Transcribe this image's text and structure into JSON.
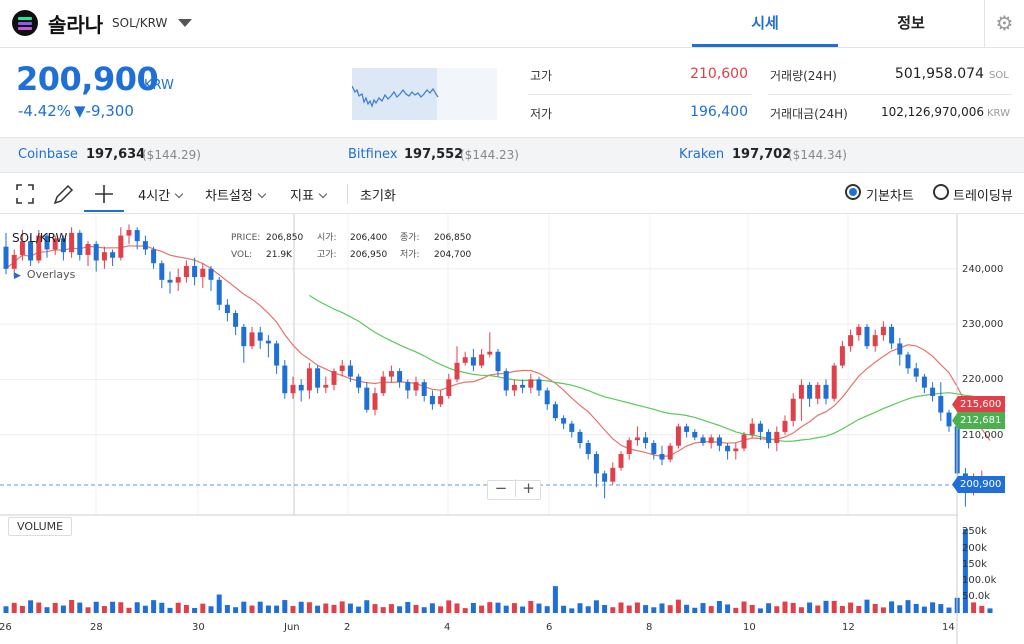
{
  "header": {
    "coin_name": "솔라나",
    "pair": "SOL/KRW",
    "tabs": [
      {
        "label": "시세",
        "active": true
      },
      {
        "label": "정보",
        "active": false
      }
    ],
    "settings_icon": "gear-icon"
  },
  "summary": {
    "price": "200,900",
    "price_unit": "KRW",
    "change_rate": "-4.42%",
    "change_amount": "▼-9,300",
    "high_label": "고가",
    "high_value": "210,600",
    "low_label": "저가",
    "low_value": "196,400",
    "volume_label": "거래량(24H)",
    "volume_value": "501,958.074",
    "volume_unit": "SOL",
    "amount_label": "거래대금(24H)",
    "amount_value": "102,126,970,006",
    "amount_unit": "KRW"
  },
  "exchanges": [
    {
      "name": "Coinbase",
      "price": "197,634",
      "usd": "($144.29)"
    },
    {
      "name": "Bitfinex",
      "price": "197,552",
      "usd": "($144.23)"
    },
    {
      "name": "Kraken",
      "price": "197,702",
      "usd": "($144.34)"
    }
  ],
  "toolbar": {
    "interval": "4시간",
    "chart_settings": "차트설정",
    "indicators": "지표",
    "reset": "초기화",
    "view_basic": "기본차트",
    "view_tradingview": "트레이딩뷰"
  },
  "chart": {
    "symbol": "SOL/KRW",
    "overlays_label": "Overlays",
    "info": {
      "price_label": "PRICE:",
      "price": "206,850",
      "open_label": "시가:",
      "open": "206,400",
      "close_label": "종가:",
      "close": "206,850",
      "vol_label": "VOL:",
      "vol": "21.9K",
      "high_label": "고가:",
      "high": "206,950",
      "low_label": "저가:",
      "low": "204,700"
    },
    "price_axis": [
      "240,000",
      "230,000",
      "220,000",
      "210,000"
    ],
    "volume_axis": [
      "250k",
      "200k",
      "150k",
      "100.0k",
      "50.0k"
    ],
    "time_axis": [
      "26",
      "28",
      "30",
      "Jun",
      "2",
      "4",
      "6",
      "8",
      "10",
      "12",
      "14"
    ],
    "volume_label": "VOLUME",
    "tags": {
      "ma_long": "215,600",
      "ma_short": "212,681",
      "last": "200,900"
    },
    "colors": {
      "up": "#e0404a",
      "down": "#1f6fd6",
      "ma_long": "#e8736b",
      "ma_short": "#5cc85c",
      "accent": "#1f6fd6"
    }
  },
  "chart_data": {
    "type": "candlestick",
    "ylim": [
      195000,
      245000
    ],
    "candles": [
      [
        244000,
        240000,
        246500,
        239000
      ],
      [
        240000,
        242500,
        243500,
        238500
      ],
      [
        242500,
        245000,
        247000,
        241500
      ],
      [
        245000,
        241500,
        246000,
        240500
      ],
      [
        241500,
        246000,
        247000,
        241000
      ],
      [
        246000,
        243500,
        246500,
        242000
      ],
      [
        243500,
        245500,
        246000,
        242500
      ],
      [
        245500,
        243000,
        246000,
        241500
      ],
      [
        243000,
        246500,
        247500,
        242000
      ],
      [
        246500,
        242500,
        247000,
        241500
      ],
      [
        242500,
        244500,
        245000,
        240500
      ],
      [
        244500,
        241500,
        245000,
        239500
      ],
      [
        241500,
        243000,
        244000,
        240000
      ],
      [
        243000,
        242000,
        243500,
        240500
      ],
      [
        242000,
        246000,
        247500,
        241500
      ],
      [
        246000,
        247000,
        248000,
        244500
      ],
      [
        247000,
        245000,
        247500,
        243500
      ],
      [
        245000,
        243500,
        246000,
        242500
      ],
      [
        243500,
        241000,
        244000,
        240000
      ],
      [
        241000,
        238000,
        241500,
        236500
      ],
      [
        238000,
        237500,
        239500,
        235500
      ],
      [
        237500,
        238500,
        240000,
        236000
      ],
      [
        238500,
        240500,
        241500,
        237500
      ],
      [
        240500,
        238500,
        242000,
        237000
      ],
      [
        238500,
        240000,
        241000,
        236500
      ],
      [
        240000,
        238000,
        240500,
        236000
      ],
      [
        238000,
        233500,
        238500,
        232500
      ],
      [
        233500,
        232000,
        234500,
        230500
      ],
      [
        232000,
        229500,
        232500,
        228000
      ],
      [
        229500,
        226000,
        230000,
        223000
      ],
      [
        226000,
        228500,
        229500,
        225500
      ],
      [
        228500,
        227000,
        229500,
        225500
      ],
      [
        227000,
        226500,
        228000,
        224000
      ],
      [
        226500,
        222500,
        227000,
        221000
      ],
      [
        222500,
        217500,
        223500,
        216500
      ],
      [
        217500,
        219000,
        220500,
        216500
      ],
      [
        219000,
        218000,
        220000,
        216000
      ],
      [
        218000,
        222000,
        223000,
        216500
      ],
      [
        222000,
        218500,
        222500,
        217500
      ],
      [
        218500,
        219000,
        220500,
        217500
      ],
      [
        219000,
        221500,
        222000,
        218000
      ],
      [
        221500,
        222500,
        223500,
        220500
      ],
      [
        222500,
        220500,
        223500,
        219500
      ],
      [
        220500,
        218500,
        221000,
        217500
      ],
      [
        218500,
        214500,
        219500,
        214000
      ],
      [
        214500,
        217500,
        218500,
        213500
      ],
      [
        217500,
        220500,
        221500,
        217000
      ],
      [
        220500,
        221500,
        222500,
        219500
      ],
      [
        221500,
        219500,
        222000,
        218500
      ],
      [
        219500,
        218000,
        220000,
        216500
      ],
      [
        218000,
        219500,
        220500,
        217000
      ],
      [
        219500,
        217000,
        220000,
        216000
      ],
      [
        217000,
        215500,
        218000,
        214500
      ],
      [
        215500,
        217000,
        218000,
        215000
      ],
      [
        217000,
        220000,
        221000,
        216500
      ],
      [
        220000,
        223000,
        226000,
        219500
      ],
      [
        223000,
        224000,
        225000,
        222500
      ],
      [
        224000,
        222500,
        225500,
        221500
      ],
      [
        222500,
        224500,
        225500,
        222000
      ],
      [
        224500,
        225000,
        228500,
        224000
      ],
      [
        225000,
        221500,
        225500,
        220500
      ],
      [
        221500,
        218000,
        222000,
        217000
      ],
      [
        218000,
        219000,
        220000,
        217000
      ],
      [
        219000,
        218500,
        220000,
        217500
      ],
      [
        218500,
        220000,
        221000,
        217500
      ],
      [
        220000,
        218000,
        220500,
        217000
      ],
      [
        218000,
        215500,
        218500,
        214500
      ],
      [
        215500,
        213000,
        216000,
        212500
      ],
      [
        213000,
        212000,
        213500,
        211000
      ],
      [
        212000,
        210500,
        212500,
        209500
      ],
      [
        210500,
        208500,
        211000,
        207500
      ],
      [
        208500,
        206500,
        209000,
        205500
      ],
      [
        206500,
        203000,
        207000,
        200500
      ],
      [
        203000,
        201500,
        203500,
        198500
      ],
      [
        201500,
        204000,
        205000,
        201000
      ],
      [
        204000,
        206500,
        207000,
        203500
      ],
      [
        206500,
        209000,
        209500,
        205500
      ],
      [
        209000,
        209500,
        211500,
        208000
      ],
      [
        209500,
        208500,
        210500,
        207500
      ],
      [
        208500,
        206500,
        209000,
        205500
      ],
      [
        206500,
        205500,
        208000,
        204500
      ],
      [
        205500,
        208000,
        208500,
        205000
      ],
      [
        208000,
        211500,
        212000,
        207500
      ],
      [
        211500,
        210500,
        212000,
        209500
      ],
      [
        210500,
        209500,
        211000,
        209000
      ],
      [
        209500,
        208500,
        210000,
        208000
      ],
      [
        208500,
        209500,
        210000,
        207500
      ],
      [
        209500,
        208000,
        210000,
        207000
      ],
      [
        208000,
        207000,
        208500,
        205500
      ],
      [
        207000,
        207500,
        208500,
        205500
      ],
      [
        207500,
        210000,
        210500,
        207000
      ],
      [
        210000,
        212000,
        213000,
        209500
      ],
      [
        212000,
        210500,
        212500,
        209000
      ],
      [
        210500,
        208500,
        211000,
        207500
      ],
      [
        208500,
        210500,
        211500,
        207000
      ],
      [
        210500,
        212500,
        213500,
        210000
      ],
      [
        212500,
        216500,
        217500,
        211500
      ],
      [
        216500,
        219000,
        220000,
        212500
      ],
      [
        219000,
        216500,
        219500,
        215000
      ],
      [
        216500,
        219000,
        219500,
        215500
      ],
      [
        219000,
        216500,
        220000,
        215500
      ],
      [
        216500,
        222500,
        223000,
        216000
      ],
      [
        222500,
        226000,
        227000,
        222000
      ],
      [
        226000,
        228000,
        229000,
        225000
      ],
      [
        228000,
        229500,
        230000,
        227000
      ],
      [
        229500,
        226000,
        230000,
        225500
      ],
      [
        226000,
        228000,
        229000,
        225000
      ],
      [
        228000,
        229500,
        230500,
        227000
      ],
      [
        229500,
        226500,
        230000,
        225500
      ],
      [
        226500,
        224500,
        227500,
        222500
      ],
      [
        224500,
        222000,
        225000,
        221000
      ],
      [
        222000,
        220500,
        223000,
        219500
      ],
      [
        220500,
        218500,
        221000,
        217500
      ],
      [
        218500,
        217000,
        219500,
        216000
      ],
      [
        217000,
        214000,
        219500,
        212500
      ],
      [
        214000,
        211500,
        214500,
        210500
      ],
      [
        211500,
        203000,
        212000,
        200000
      ],
      [
        203000,
        200500,
        204000,
        197000
      ],
      [
        200500,
        201500,
        203000,
        199000
      ],
      [
        201500,
        202000,
        203500,
        200500
      ],
      [
        202000,
        200900,
        202500,
        200000
      ]
    ],
    "volume_max": 250
  }
}
